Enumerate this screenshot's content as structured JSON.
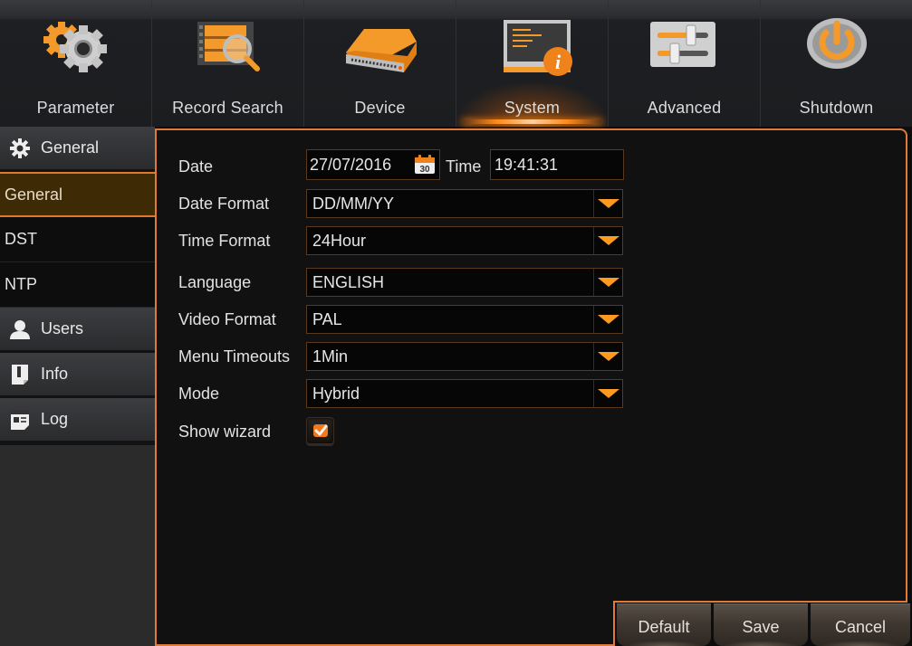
{
  "topnav": {
    "tabs": [
      {
        "label": "Parameter",
        "icon": "gears-icon",
        "active": false
      },
      {
        "label": "Record Search",
        "icon": "film-search-icon",
        "active": false
      },
      {
        "label": "Device",
        "icon": "hard-drive-icon",
        "active": false
      },
      {
        "label": "System",
        "icon": "system-info-icon",
        "active": true
      },
      {
        "label": "Advanced",
        "icon": "sliders-icon",
        "active": false
      },
      {
        "label": "Shutdown",
        "icon": "power-icon",
        "active": false
      }
    ]
  },
  "sidebar": {
    "sections": [
      {
        "label": "General",
        "icon": "gear-icon",
        "children": [
          "General",
          "DST",
          "NTP"
        ],
        "active_child": "General"
      },
      {
        "label": "Users",
        "icon": "user-icon"
      },
      {
        "label": "Info",
        "icon": "info-doc-icon"
      },
      {
        "label": "Log",
        "icon": "log-doc-icon"
      }
    ]
  },
  "form": {
    "date": {
      "label": "Date",
      "value": "27/07/2016",
      "calendar_day": "30"
    },
    "time": {
      "label": "Time",
      "value": "19:41:31"
    },
    "date_format": {
      "label": "Date Format",
      "value": "DD/MM/YY"
    },
    "time_format": {
      "label": "Time Format",
      "value": "24Hour"
    },
    "language": {
      "label": "Language",
      "value": "ENGLISH"
    },
    "video_format": {
      "label": "Video Format",
      "value": "PAL"
    },
    "menu_timeouts": {
      "label": "Menu Timeouts",
      "value": "1Min"
    },
    "mode": {
      "label": "Mode",
      "value": "Hybrid"
    },
    "show_wizard": {
      "label": "Show wizard",
      "checked": true
    }
  },
  "buttons": {
    "default": "Default",
    "save": "Save",
    "cancel": "Cancel"
  },
  "colors": {
    "accent": "#e07a3a",
    "dropdown_arrow": "#ff9a20",
    "active_sidebar_bg": "#3f2a06"
  }
}
